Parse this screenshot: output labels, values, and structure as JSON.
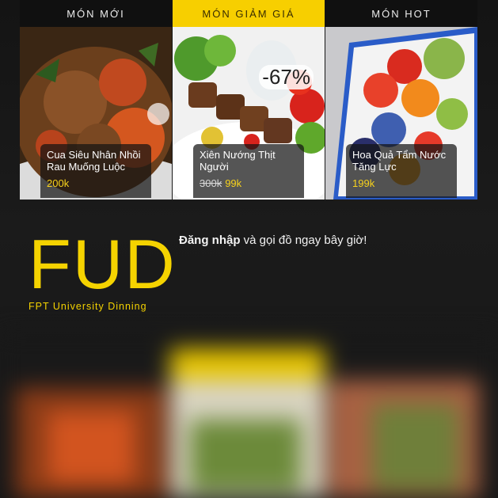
{
  "tabs": {
    "new": "MÓN MỚI",
    "sale": "MÓN GIẢM GIÁ",
    "hot": "MÓN HOT"
  },
  "cards": [
    {
      "name": "Cua Siêu Nhân Nhồi Rau Muống Luộc",
      "price": "200k"
    },
    {
      "name": "Xiên Nướng Thịt Người",
      "old_price": "300k",
      "price": "99k",
      "discount": "-67%"
    },
    {
      "name": "Hoa Quả Tẩm Nước Tăng Lực",
      "price": "199k"
    }
  ],
  "brand": {
    "logo": "FUD",
    "tagline": "FPT University Dinning"
  },
  "cta": {
    "bold": "Đăng nhập",
    "rest": " và gọi đồ ngay bây giờ!"
  },
  "colors": {
    "accent": "#f7cf00",
    "background": "#1a1a1a",
    "price": "#f7d21c"
  }
}
